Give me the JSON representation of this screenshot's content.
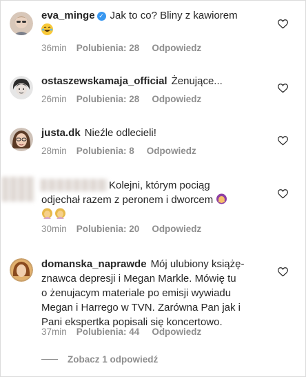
{
  "comments": [
    {
      "username": "eva_minge",
      "text": "Jak to co? Bliny z kawiorem",
      "time": "36min",
      "likes": "Polubienia: 28",
      "reply": "Odpowiedz",
      "verified": true,
      "emoji": "laughing-emoji"
    },
    {
      "username": "ostaszewskamaja_official",
      "text": "Żenujące...",
      "time": "26min",
      "likes": "Polubienia: 28",
      "reply": "Odpowiedz"
    },
    {
      "username": "justa.dk",
      "text": "Nieźle odlecieli!",
      "time": "28min",
      "likes": "Polubienia: 8",
      "reply": "Odpowiedz"
    },
    {
      "username": "",
      "text_line1": "Kolejni, którym pociąg",
      "text_line2": "odjechał razem z peronem i dworcem",
      "time": "30min",
      "likes": "Polubienia: 20",
      "reply": "Odpowiedz",
      "emoji": [
        "woman-facepalming-emoji",
        "woman-facepalming-emoji",
        "woman-facepalming-emoji"
      ]
    },
    {
      "username": "domanska_naprawde",
      "text_line1": "Mój ulubiony książę-",
      "text_line2": "znawca depresji i Megan Markle. Mówię tu",
      "text_line3": "o żenujacym materiale po emisji wywiadu",
      "text_line4": "Megan i Harrego w TVN. Zarówna Pan jak i",
      "text_line5": "Pani ekspertka popisali się koncertowo.",
      "time": "37min",
      "likes": "Polubienia: 44",
      "reply": "Odpowiedz"
    }
  ],
  "view_replies": "Zobacz 1 odpowiedź",
  "colors": {
    "text": "#262626",
    "secondary": "#8e8e8e",
    "verified": "#3897f0",
    "heart_outline": "#262626"
  }
}
